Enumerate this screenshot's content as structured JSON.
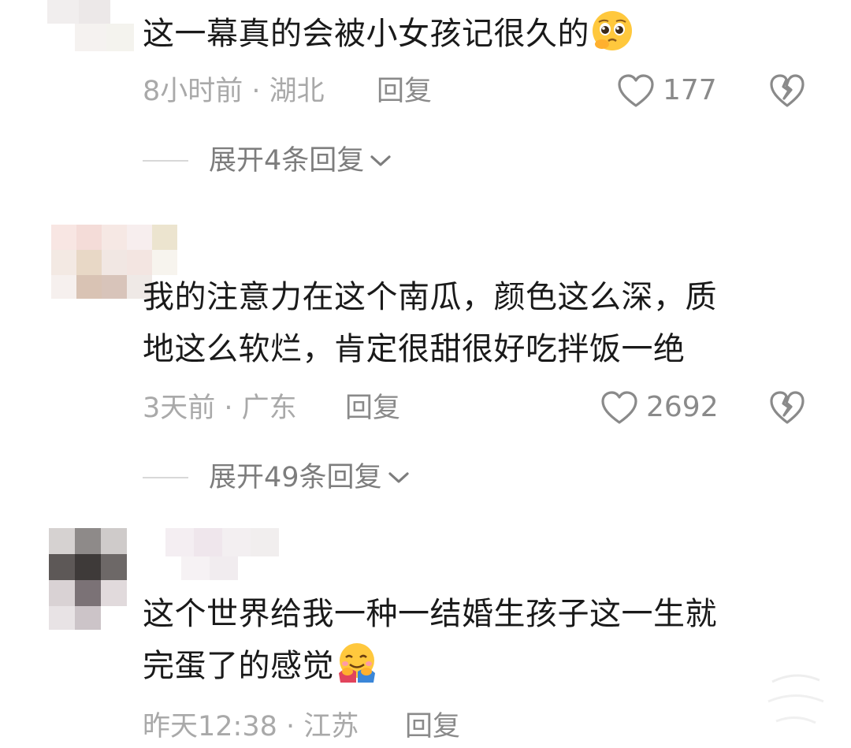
{
  "comments": [
    {
      "text_lines": [
        "这一幕真的会被小女孩记很久的"
      ],
      "emoji": "pleading-face-emoji",
      "meta": "8小时前 · 湖北",
      "reply_label": "回复",
      "likes": "177",
      "expand_label": "展开4条回复"
    },
    {
      "text_lines": [
        "我的注意力在这个南瓜，颜色这么深，质",
        "地这么软烂，肯定很甜很好吃拌饭一绝"
      ],
      "meta": "3天前 · 广东",
      "reply_label": "回复",
      "likes": "2692",
      "expand_label": "展开49条回复"
    },
    {
      "text_lines": [
        "这个世界给我一种一结婚生孩子这一生就",
        "完蛋了的感觉"
      ],
      "emoji": "hugging-face-emoji",
      "meta": "昨天12:38 · 江苏",
      "reply_label": "回复"
    }
  ],
  "colors": {
    "text": "#1a1a1a",
    "meta": "#a9a9a9",
    "action": "#8a8a8a",
    "divider": "#d8d8d8"
  }
}
